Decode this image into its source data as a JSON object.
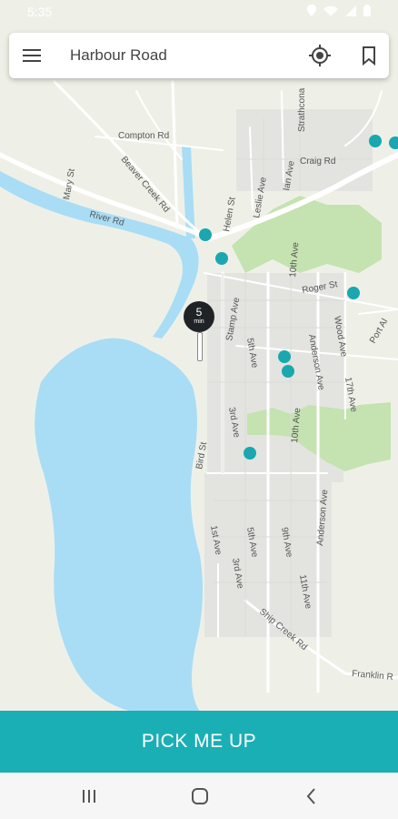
{
  "status_bar": {
    "time": "5:35"
  },
  "search_bar": {
    "location": "Harbour Road"
  },
  "map": {
    "pin": {
      "minutes": "5",
      "unit": "min"
    },
    "streets": {
      "compton": "Compton Rd",
      "beaver_creek": "Beaver Creek Rd",
      "mary": "Mary St",
      "river": "River Rd",
      "helen": "Helen St",
      "leslie": "Leslie Ave",
      "ian": "Ian Ave",
      "craig": "Craig Rd",
      "strathcona": "Strathcona",
      "tenth_top": "10th Ave",
      "roger": "Roger St",
      "wood": "Wood Ave",
      "port": "Port Al",
      "stamp": "Stamp Ave",
      "fifth_top": "5th Ave",
      "anderson_top": "Anderson Ave",
      "seventeenth": "17th Ave",
      "third_top": "3rd Ave",
      "tenth_mid": "10th Ave",
      "bird": "Bird St",
      "anderson_bottom": "Anderson Ave",
      "first": "1st Ave",
      "fifth_bottom": "5th Ave",
      "ninth": "9th Ave",
      "third_bottom": "3rd Ave",
      "eleventh": "11th Ave",
      "ship_creek": "Ship Creek Rd",
      "franklin": "Franklin R"
    }
  },
  "pickup_button": {
    "label": "PICK ME UP"
  },
  "colors": {
    "accent": "#1aafb4",
    "water": "#a8ddf5",
    "park": "#c4e3b0",
    "vehicle": "#1aa7b0"
  },
  "icons": [
    "menu-icon",
    "gps-locate-icon",
    "bookmark-icon",
    "recent-apps-icon",
    "home-icon",
    "back-icon"
  ]
}
